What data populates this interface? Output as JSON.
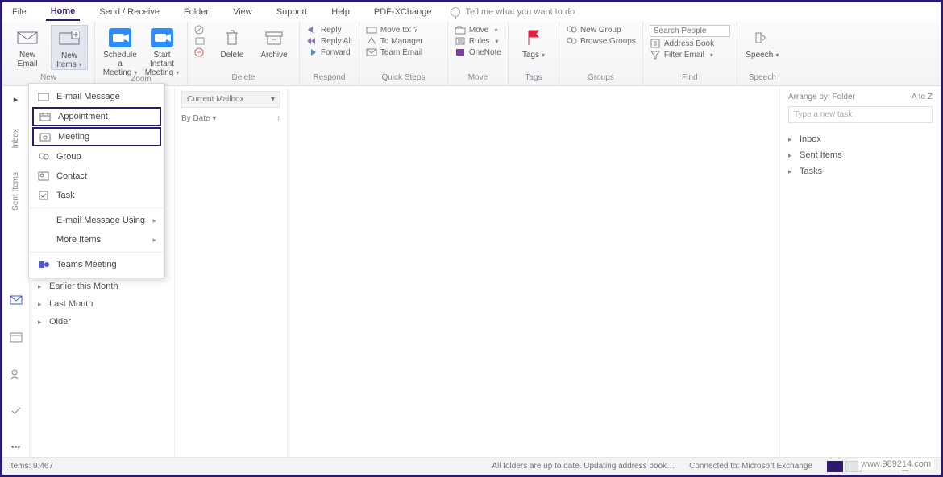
{
  "tabs": {
    "file": "File",
    "home": "Home",
    "sendreceive": "Send / Receive",
    "folder": "Folder",
    "view": "View",
    "support": "Support",
    "help": "Help",
    "pdfx": "PDF-XChange",
    "tellme": "Tell me what you want to do"
  },
  "ribbon": {
    "new": {
      "label": "New",
      "new_email": "New\nEmail",
      "new_items": "New\nItems"
    },
    "zoom": {
      "label": "Zoom",
      "schedule": "Schedule a\nMeeting",
      "instant": "Start Instant\nMeeting"
    },
    "delete": {
      "label": "Delete",
      "delete_btn": "Delete",
      "archive_btn": "Archive"
    },
    "respond": {
      "label": "Respond"
    },
    "quicksteps": {
      "label": "Quick Steps",
      "moveto": "Move to: ?",
      "tomanager": "To Manager",
      "teamemail": "Team Email"
    },
    "move": {
      "label": "Move",
      "move_btn": "Move",
      "rules": "Rules",
      "onenote": "OneNote"
    },
    "tags": {
      "label": "Tags",
      "tags_btn": "Tags"
    },
    "groups": {
      "label": "Groups",
      "new_group": "New Group",
      "browse_groups": "Browse Groups"
    },
    "find": {
      "label": "Find",
      "search_placeholder": "Search People",
      "address_book": "Address Book",
      "filter_email": "Filter Email"
    },
    "speech": {
      "label": "Speech",
      "speech_btn": "Speech"
    }
  },
  "rail": {
    "label1": "Inbox",
    "label2": "Sent Items"
  },
  "menu": {
    "email": "E-mail Message",
    "appointment": "Appointment",
    "meeting": "Meeting",
    "group": "Group",
    "contact": "Contact",
    "task": "Task",
    "email_using": "E-mail Message Using",
    "more": "More Items",
    "teams": "Teams Meeting"
  },
  "nav_groups": {
    "earlier": "Earlier this Month",
    "last_month": "Last Month",
    "older": "Older"
  },
  "list": {
    "header": "Current Mailbox",
    "sort": "By Date"
  },
  "todo": {
    "header_left": "Arrange by: Folder",
    "header_right": "A to Z",
    "placeholder": "Type a new task",
    "items": [
      "Inbox",
      "Sent Items",
      "Tasks"
    ]
  },
  "status": {
    "left": "Items: 9,467",
    "mid": "All folders are up to date.   Updating address book…",
    "right": "Connected to: Microsoft Exchange"
  },
  "watermark": "www.989214.com"
}
